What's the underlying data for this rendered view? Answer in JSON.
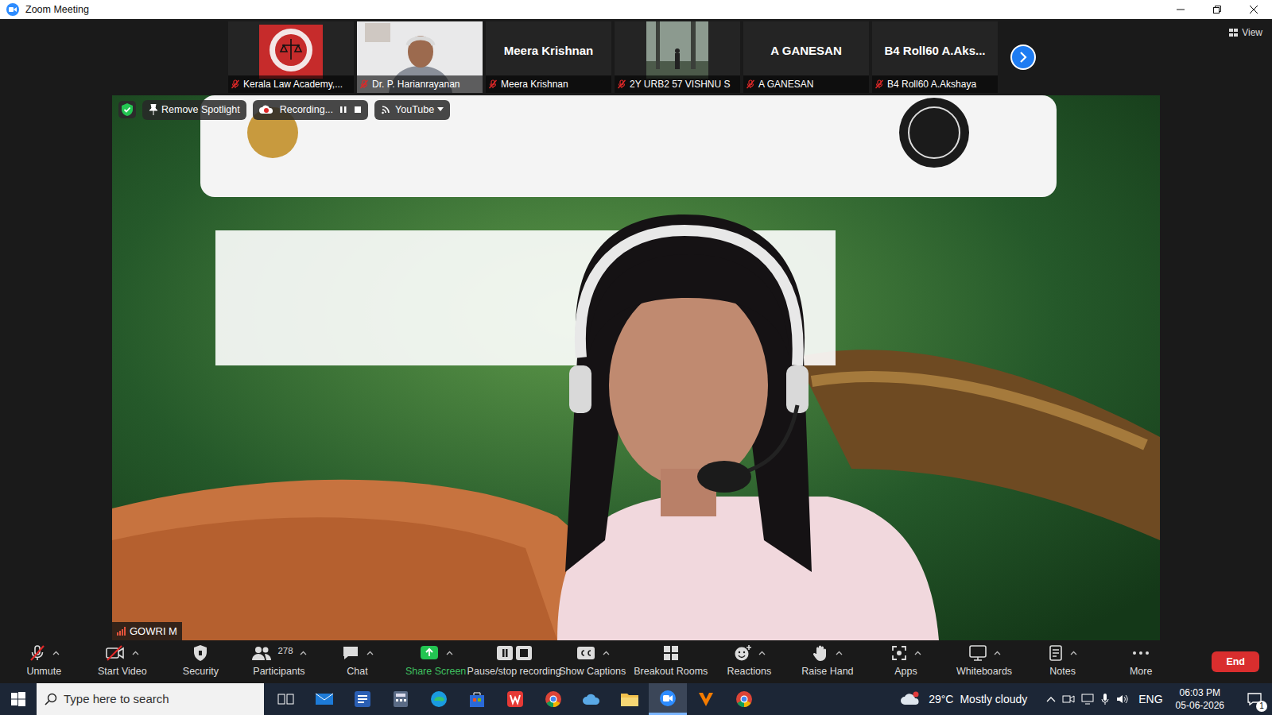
{
  "window": {
    "title": "Zoom Meeting"
  },
  "thumbnails": [
    {
      "kind": "logo",
      "label": "Kerala Law Academy,...",
      "muted": true
    },
    {
      "kind": "camera",
      "label": "Dr. P. Harianrayanan",
      "muted": true
    },
    {
      "kind": "name",
      "display": "Meera Krishnan",
      "label": "Meera Krishnan",
      "muted": true
    },
    {
      "kind": "photo",
      "label": "2Y URB2 57 VISHNU S",
      "muted": true
    },
    {
      "kind": "name",
      "display": "A GANESAN",
      "label": "A GANESAN",
      "muted": true
    },
    {
      "kind": "name",
      "display": "B4 Roll60 A.Aks...",
      "label": "B4 Roll60 A.Akshaya",
      "muted": true
    }
  ],
  "view_button": "View",
  "overlay": {
    "spotlight": "Remove Spotlight",
    "recording": "Recording...",
    "stream": "YouTube"
  },
  "speaker": {
    "name": "GOWRI M"
  },
  "toolbar": [
    {
      "kind": "mic",
      "label": "Unmute",
      "menu": true
    },
    {
      "kind": "video",
      "label": "Start Video",
      "menu": true
    },
    {
      "kind": "security",
      "label": "Security",
      "menu": false
    },
    {
      "kind": "participants",
      "label": "Participants",
      "count": "278",
      "menu": true
    },
    {
      "kind": "chat",
      "label": "Chat",
      "menu": true
    },
    {
      "kind": "share",
      "label": "Share Screen",
      "menu": true
    },
    {
      "kind": "record",
      "label": "Pause/stop recording",
      "menu": false
    },
    {
      "kind": "captions",
      "label": "Show Captions",
      "menu": true
    },
    {
      "kind": "breakout",
      "label": "Breakout Rooms",
      "menu": false
    },
    {
      "kind": "reactions",
      "label": "Reactions",
      "menu": true
    },
    {
      "kind": "hand",
      "label": "Raise Hand",
      "menu": true
    },
    {
      "kind": "apps",
      "label": "Apps",
      "menu": true
    },
    {
      "kind": "whiteboard",
      "label": "Whiteboards",
      "menu": true
    },
    {
      "kind": "notes",
      "label": "Notes",
      "menu": true
    },
    {
      "kind": "more",
      "label": "More",
      "menu": false
    }
  ],
  "end_button": "End",
  "taskbar": {
    "search_placeholder": "Type here to search",
    "apps": [
      {
        "kind": "taskview",
        "selected": false
      },
      {
        "kind": "mail",
        "selected": false
      },
      {
        "kind": "word",
        "selected": false
      },
      {
        "kind": "calc",
        "selected": false
      },
      {
        "kind": "edge",
        "selected": false
      },
      {
        "kind": "store",
        "selected": false
      },
      {
        "kind": "wps",
        "selected": false
      },
      {
        "kind": "chrome",
        "selected": false
      },
      {
        "kind": "cloud",
        "selected": false
      },
      {
        "kind": "folder",
        "selected": false
      },
      {
        "kind": "zoom",
        "selected": true
      },
      {
        "kind": "vlc",
        "selected": false
      },
      {
        "kind": "chrome",
        "selected": false
      }
    ],
    "weather": "29°C",
    "weather_text": "Mostly cloudy",
    "language": "ENG",
    "time": "06:03 PM",
    "date": "05-06-2026",
    "notifications": "1"
  }
}
